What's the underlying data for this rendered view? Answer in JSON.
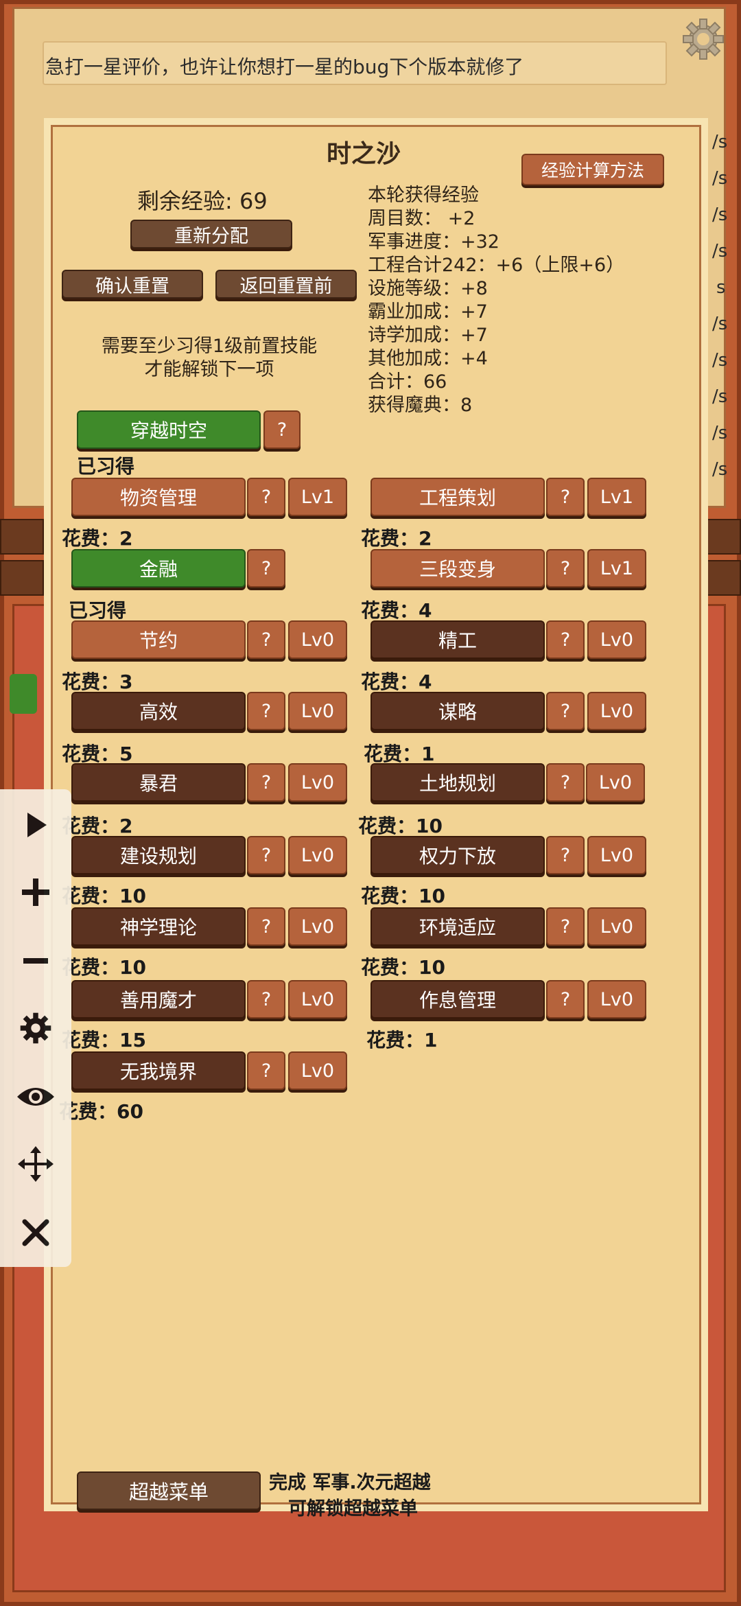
{
  "notice": "急打一星评价，也许让你想打一星的bug下个版本就修了",
  "panel": {
    "title": "时之沙",
    "exp_method_button": "经验计算方法",
    "remaining_exp": "剩余经验: 69",
    "redistribute_button": "重新分配",
    "confirm_reset_button": "确认重置",
    "revert_reset_button": "返回重置前",
    "hint_line1": "需要至少习得1级前置技能",
    "hint_line2": "才能解锁下一项"
  },
  "exp_stats": [
    "本轮获得经验",
    "周目数： +2",
    "军事进度：+32",
    "工程合计242：+6（上限+6）",
    "设施等级：+8",
    "霸业加成：+7",
    "诗学加成：+7",
    "其他加成：+4",
    "合计：66",
    "获得魔典：8"
  ],
  "root_skill": {
    "name": "穿越时空",
    "help": "?",
    "status": "已习得"
  },
  "left_skills": [
    {
      "name": "物资管理",
      "help": "?",
      "level": "Lv1",
      "cost": "花费：2"
    },
    {
      "name": "金融",
      "help": "?",
      "level": "",
      "cost": "已习得"
    },
    {
      "name": "节约",
      "help": "?",
      "level": "Lv0",
      "cost": "花费：3"
    },
    {
      "name": "高效",
      "help": "?",
      "level": "Lv0",
      "cost": "花费：5"
    },
    {
      "name": "暴君",
      "help": "?",
      "level": "Lv0",
      "cost": "花费：2"
    },
    {
      "name": "建设规划",
      "help": "?",
      "level": "Lv0",
      "cost": "花费：10"
    },
    {
      "name": "神学理论",
      "help": "?",
      "level": "Lv0",
      "cost": "花费：10"
    },
    {
      "name": "善用魔才",
      "help": "?",
      "level": "Lv0",
      "cost": "花费：15"
    },
    {
      "name": "无我境界",
      "help": "?",
      "level": "Lv0",
      "cost": "花费：60"
    }
  ],
  "right_skills": [
    {
      "name": "工程策划",
      "help": "?",
      "level": "Lv1",
      "cost": "花费：2"
    },
    {
      "name": "三段变身",
      "help": "?",
      "level": "Lv1",
      "cost": "花费：4"
    },
    {
      "name": "精工",
      "help": "?",
      "level": "Lv0",
      "cost": "花费：4"
    },
    {
      "name": "谋略",
      "help": "?",
      "level": "Lv0",
      "cost": "花费：1"
    },
    {
      "name": "土地规划",
      "help": "?",
      "level": "Lv0",
      "cost": "花费：10"
    },
    {
      "name": "权力下放",
      "help": "?",
      "level": "Lv0",
      "cost": "花费：10"
    },
    {
      "name": "环境适应",
      "help": "?",
      "level": "Lv0",
      "cost": "花费：10"
    },
    {
      "name": "作息管理",
      "help": "?",
      "level": "Lv0",
      "cost": "花费：1"
    }
  ],
  "footer": {
    "transcend_button": "超越菜单",
    "unlock_line1": "完成 军事.次元超越",
    "unlock_line2": "可解锁超越菜单"
  },
  "side_texts": [
    "/s",
    "/s",
    "/s",
    "/s",
    "s",
    "/s",
    "/s",
    "/s",
    "/s",
    "/s"
  ],
  "toolbar_icons": [
    "play-icon",
    "plus-icon",
    "minus-icon",
    "gear-icon",
    "eye-icon",
    "move-icon",
    "close-icon"
  ]
}
